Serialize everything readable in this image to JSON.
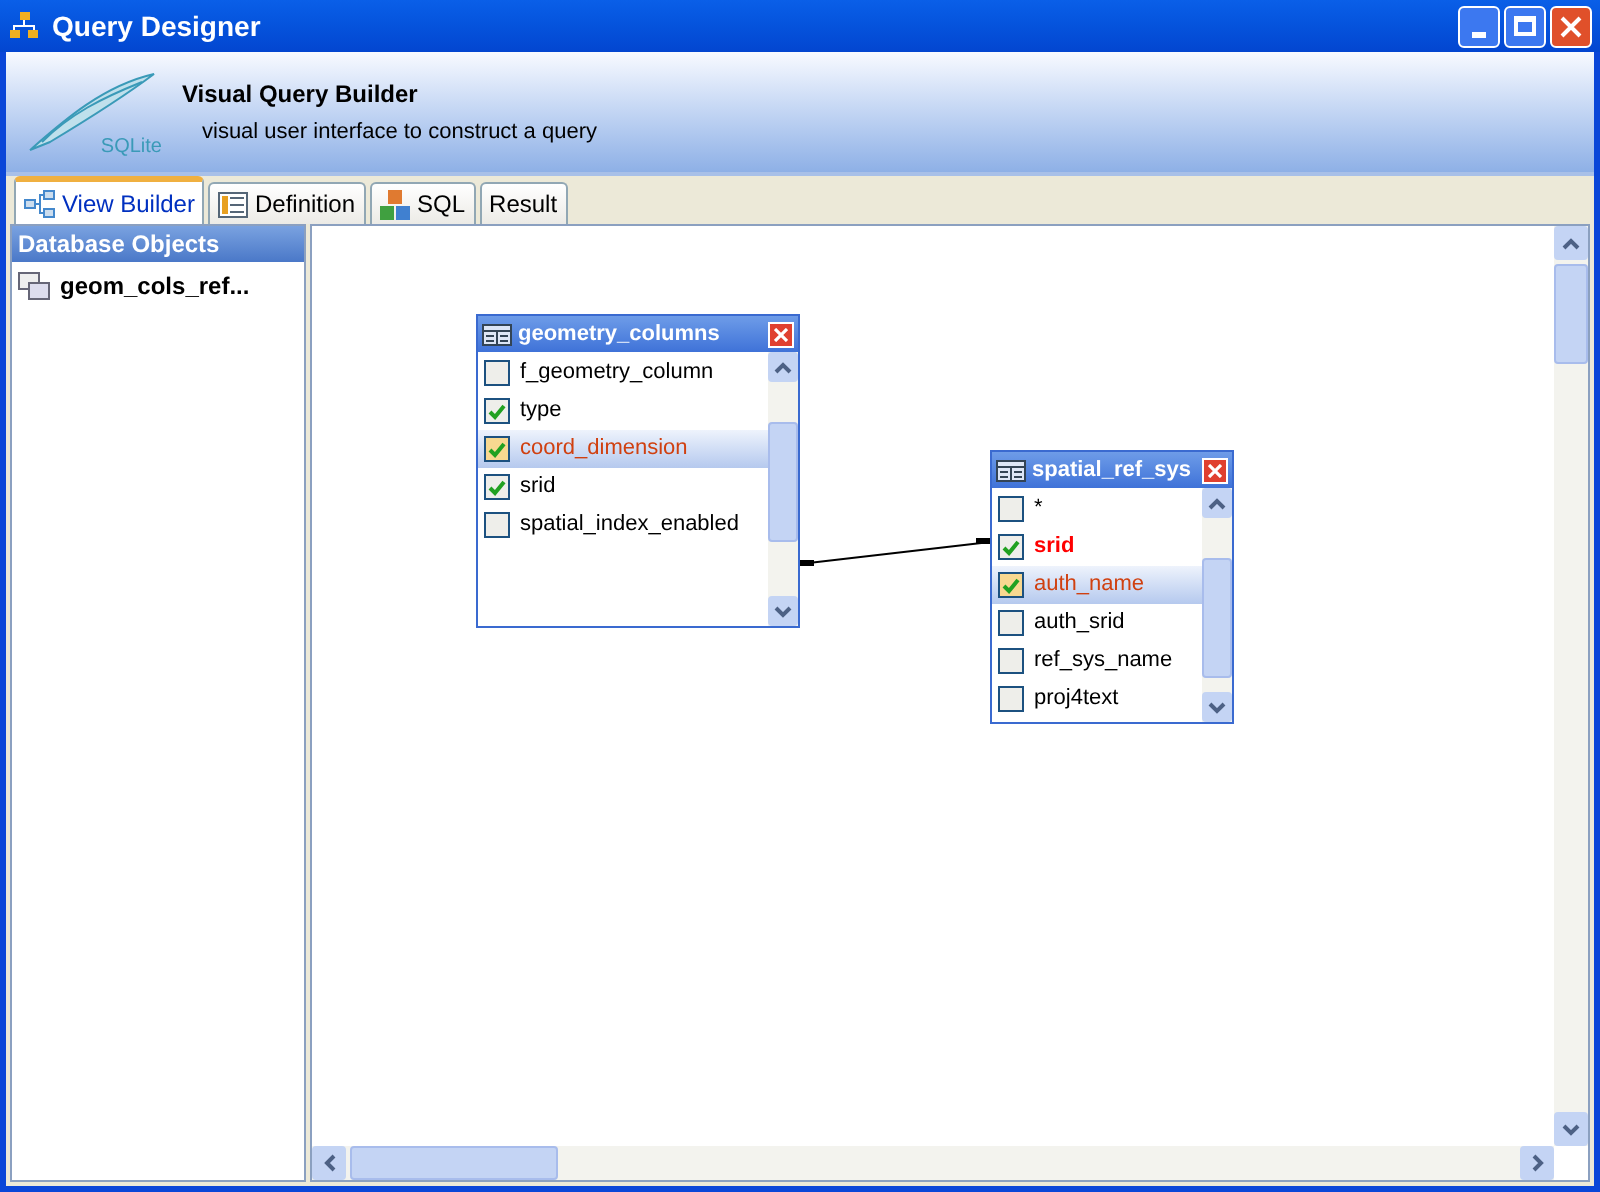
{
  "window": {
    "title": "Query Designer"
  },
  "header": {
    "title": "Visual Query Builder",
    "subtitle": "visual user interface to construct a query",
    "logo_text": "SQLite"
  },
  "tabs": [
    {
      "label": "View Builder",
      "selected": true,
      "kind": "builder"
    },
    {
      "label": "Definition",
      "selected": false,
      "kind": "definition"
    },
    {
      "label": "SQL",
      "selected": false,
      "kind": "sql"
    },
    {
      "label": "Result",
      "selected": false,
      "kind": "none"
    }
  ],
  "sidebar": {
    "title": "Database Objects",
    "items": [
      {
        "label": "geom_cols_ref..."
      }
    ]
  },
  "tables": [
    {
      "title": "geometry_columns",
      "fields": [
        {
          "name": "f_geometry_column",
          "checked": false,
          "selected": false,
          "key": false
        },
        {
          "name": "type",
          "checked": true,
          "selected": false,
          "key": false
        },
        {
          "name": "coord_dimension",
          "checked": true,
          "selected": true,
          "key": false
        },
        {
          "name": "srid",
          "checked": true,
          "selected": false,
          "key": false
        },
        {
          "name": "spatial_index_enabled",
          "checked": false,
          "selected": false,
          "key": false
        }
      ]
    },
    {
      "title": "spatial_ref_sys",
      "fields": [
        {
          "name": "*",
          "checked": false,
          "selected": false,
          "key": false
        },
        {
          "name": "srid",
          "checked": true,
          "selected": false,
          "key": true
        },
        {
          "name": "auth_name",
          "checked": true,
          "selected": true,
          "key": false
        },
        {
          "name": "auth_srid",
          "checked": false,
          "selected": false,
          "key": false
        },
        {
          "name": "ref_sys_name",
          "checked": false,
          "selected": false,
          "key": false
        },
        {
          "name": "proj4text",
          "checked": false,
          "selected": false,
          "key": false
        }
      ]
    }
  ]
}
